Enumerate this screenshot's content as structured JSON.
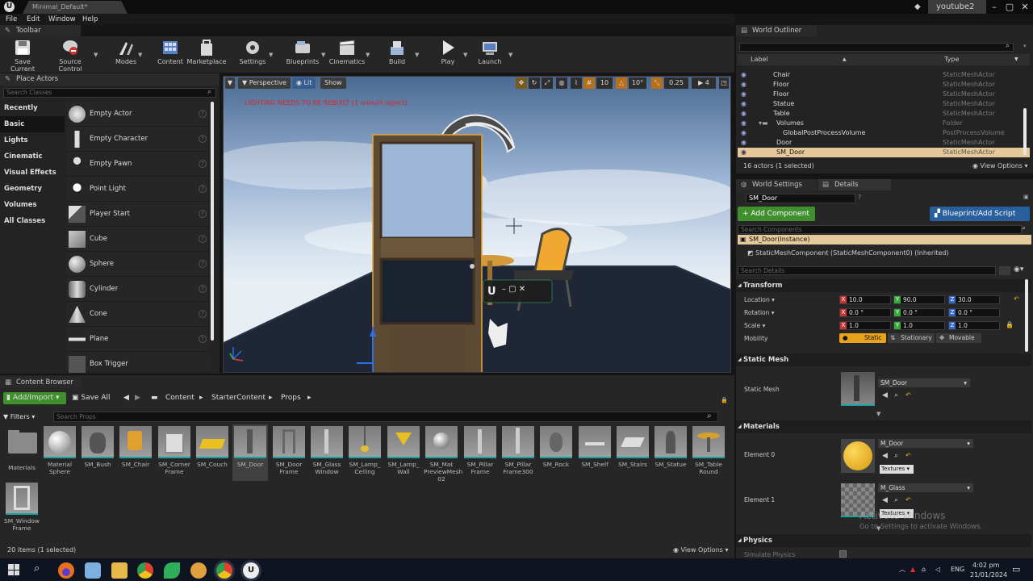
{
  "window": {
    "doc_tab": "Minimal_Default*",
    "account_tab": "youtube2"
  },
  "menu": [
    "File",
    "Edit",
    "Window",
    "Help"
  ],
  "toolbar": {
    "panel_title": "Toolbar",
    "buttons": [
      "Save Current",
      "Source Control",
      "Modes",
      "Content",
      "Marketplace",
      "Settings",
      "Blueprints",
      "Cinematics",
      "Build",
      "Play",
      "Launch"
    ]
  },
  "place_actors": {
    "title": "Place Actors",
    "search_placeholder": "Search Classes",
    "categories": [
      "Recently Placed",
      "Basic",
      "Lights",
      "Cinematic",
      "Visual Effects",
      "Geometry",
      "Volumes",
      "All Classes"
    ],
    "selected_category": "Basic",
    "actors": [
      "Empty Actor",
      "Empty Character",
      "Empty Pawn",
      "Point Light",
      "Player Start",
      "Cube",
      "Sphere",
      "Cylinder",
      "Cone",
      "Plane",
      "Box Trigger"
    ]
  },
  "viewport": {
    "perspective": "Perspective",
    "lit": "Lit",
    "show": "Show",
    "grid_snap": "10",
    "rot_snap": "10°",
    "scale_snap": "0.25",
    "cam_speed": "4",
    "warning": "LIGHTING NEEDS TO BE REBUILT (1 unbuilt object)"
  },
  "content_browser": {
    "title": "Content Browser",
    "add_import": "Add/Import",
    "save_all": "Save All",
    "path": [
      "Content",
      "StarterContent",
      "Props"
    ],
    "filters": "Filters",
    "search_placeholder": "Search Props",
    "assets": [
      "Materials",
      "Material Sphere",
      "SM_Bush",
      "SM_Chair",
      "SM_Corner Frame",
      "SM_Couch",
      "SM_Door",
      "SM_Door Frame",
      "SM_Glass Window",
      "SM_Lamp_ Ceiling",
      "SM_Lamp_ Wall",
      "SM_Mat PreviewMesh 02",
      "SM_Pillar Frame",
      "SM_Pillar Frame300",
      "SM_Rock",
      "SM_Shelf",
      "SM_Stairs",
      "SM_Statue",
      "SM_Table Round",
      "SM_Window Frame"
    ],
    "selected_asset": "SM_Door",
    "status": "20 items (1 selected)",
    "view_options": "View Options"
  },
  "outliner": {
    "title": "World Outliner",
    "col_label": "Label",
    "col_type": "Type",
    "rows": [
      {
        "name": "Chair",
        "type": "StaticMeshActor"
      },
      {
        "name": "Floor",
        "type": "StaticMeshActor"
      },
      {
        "name": "Floor",
        "type": "StaticMeshActor"
      },
      {
        "name": "Statue",
        "type": "StaticMeshActor"
      },
      {
        "name": "Table",
        "type": "StaticMeshActor"
      },
      {
        "name": "Volumes",
        "type": "Folder"
      },
      {
        "name": "GlobalPostProcessVolume",
        "type": "PostProcessVolume"
      },
      {
        "name": "Door",
        "type": "StaticMeshActor"
      },
      {
        "name": "SM_Door",
        "type": "StaticMeshActor"
      }
    ],
    "status": "16 actors (1 selected)",
    "view_options": "View Options"
  },
  "details": {
    "tab_world": "World Settings",
    "tab_details": "Details",
    "name": "SM_Door",
    "add_component": "+ Add Component",
    "blueprint": "Blueprint/Add Script",
    "search_components": "Search Components",
    "instance": "SM_Door(Instance)",
    "component": "StaticMeshComponent (StaticMeshComponent0) (Inherited)",
    "search_details": "Search Details",
    "transform": "Transform",
    "location_label": "Location",
    "rotation_label": "Rotation",
    "scale_label": "Scale",
    "mobility_label": "Mobility",
    "location": [
      "10.0",
      "90.0",
      "30.0"
    ],
    "rotation": [
      "0.0 °",
      "0.0 °",
      "0.0 °"
    ],
    "scale": [
      "1.0",
      "1.0",
      "1.0"
    ],
    "mobility": [
      "Static",
      "Stationary",
      "Movable"
    ],
    "static_mesh_section": "Static Mesh",
    "static_mesh_label": "Static Mesh",
    "static_mesh_value": "SM_Door",
    "materials_section": "Materials",
    "element0_label": "Element 0",
    "element0_value": "M_Door",
    "element1_label": "Element 1",
    "element1_value": "M_Glass",
    "textures": "Textures",
    "physics_section": "Physics",
    "simulate_physics": "Simulate Physics"
  },
  "watermark": {
    "line1": "Activate Windows",
    "line2": "Go to Settings to activate Windows."
  },
  "taskbar": {
    "lang": "ENG",
    "time": "4:02 pm",
    "date": "21/01/2024"
  },
  "colors": {
    "selection": "#e6c99a",
    "add_button": "#3f8f2f",
    "blueprint_button": "#2a5f9e",
    "warning": "#d02a2a"
  }
}
